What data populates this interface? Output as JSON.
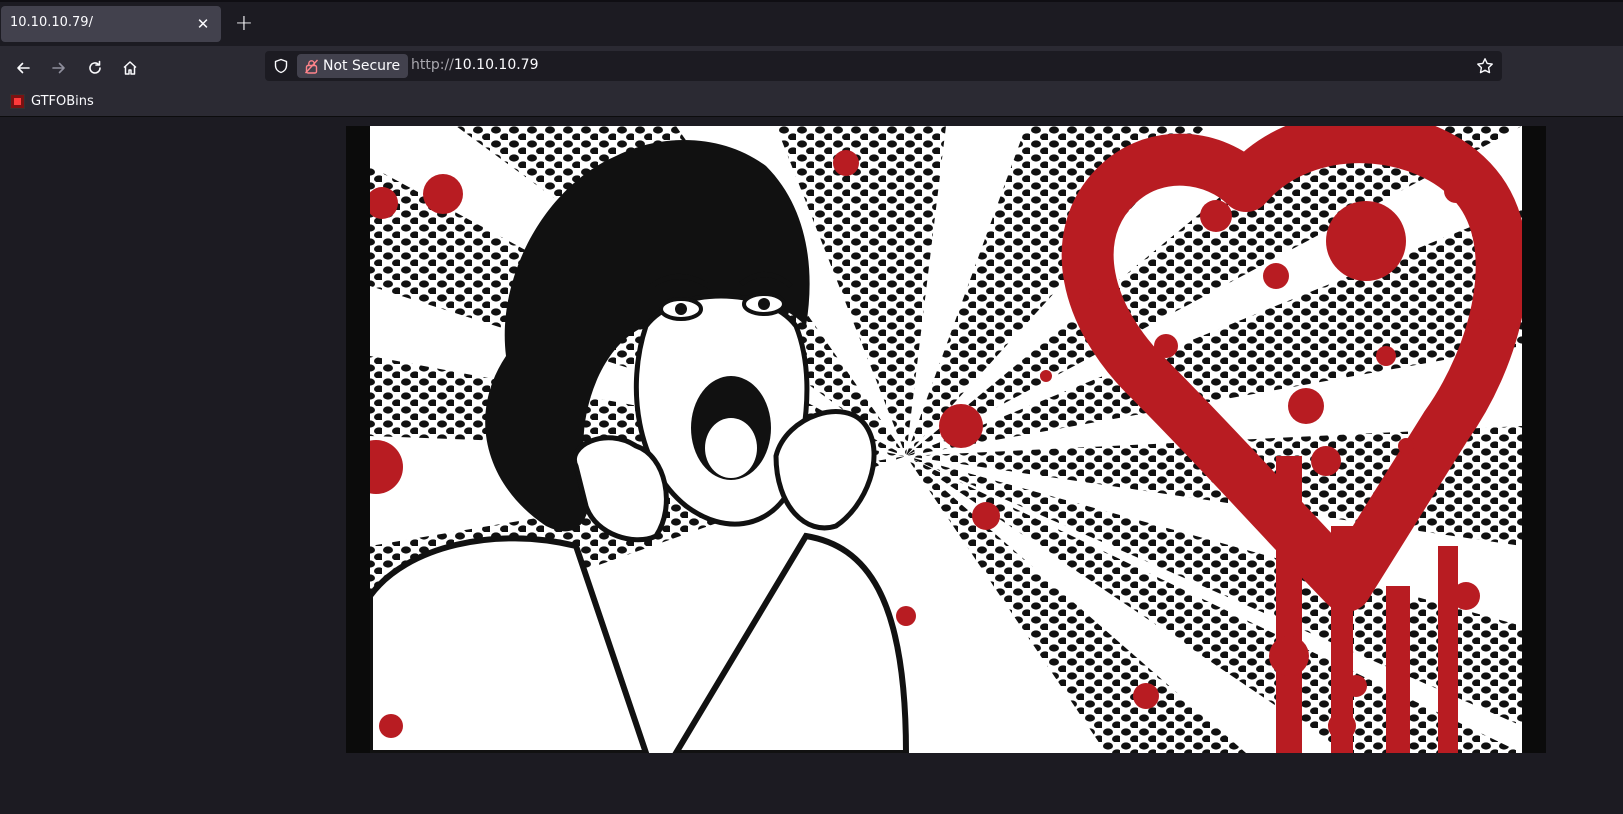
{
  "browser": {
    "tab": {
      "title": "10.10.10.79/",
      "close_icon": "close-icon"
    },
    "new_tab_icon": "plus-icon",
    "nav": {
      "back_icon": "arrow-left-icon",
      "forward_icon": "arrow-right-icon",
      "reload_icon": "reload-icon",
      "home_icon": "home-icon"
    },
    "urlbar": {
      "security_label": "Not Secure",
      "scheme": "http://",
      "host": "10.10.10.79",
      "bookmark_star_icon": "star-icon"
    },
    "bookmarks": [
      {
        "label": "GTFOBins",
        "icon": "gtfobins-favicon"
      }
    ]
  },
  "page": {
    "image": {
      "subject": "pop-art screaming woman beside a bleeding red heart",
      "colors": {
        "red": "#b81c22",
        "black": "#111111",
        "white": "#ffffff"
      }
    }
  }
}
